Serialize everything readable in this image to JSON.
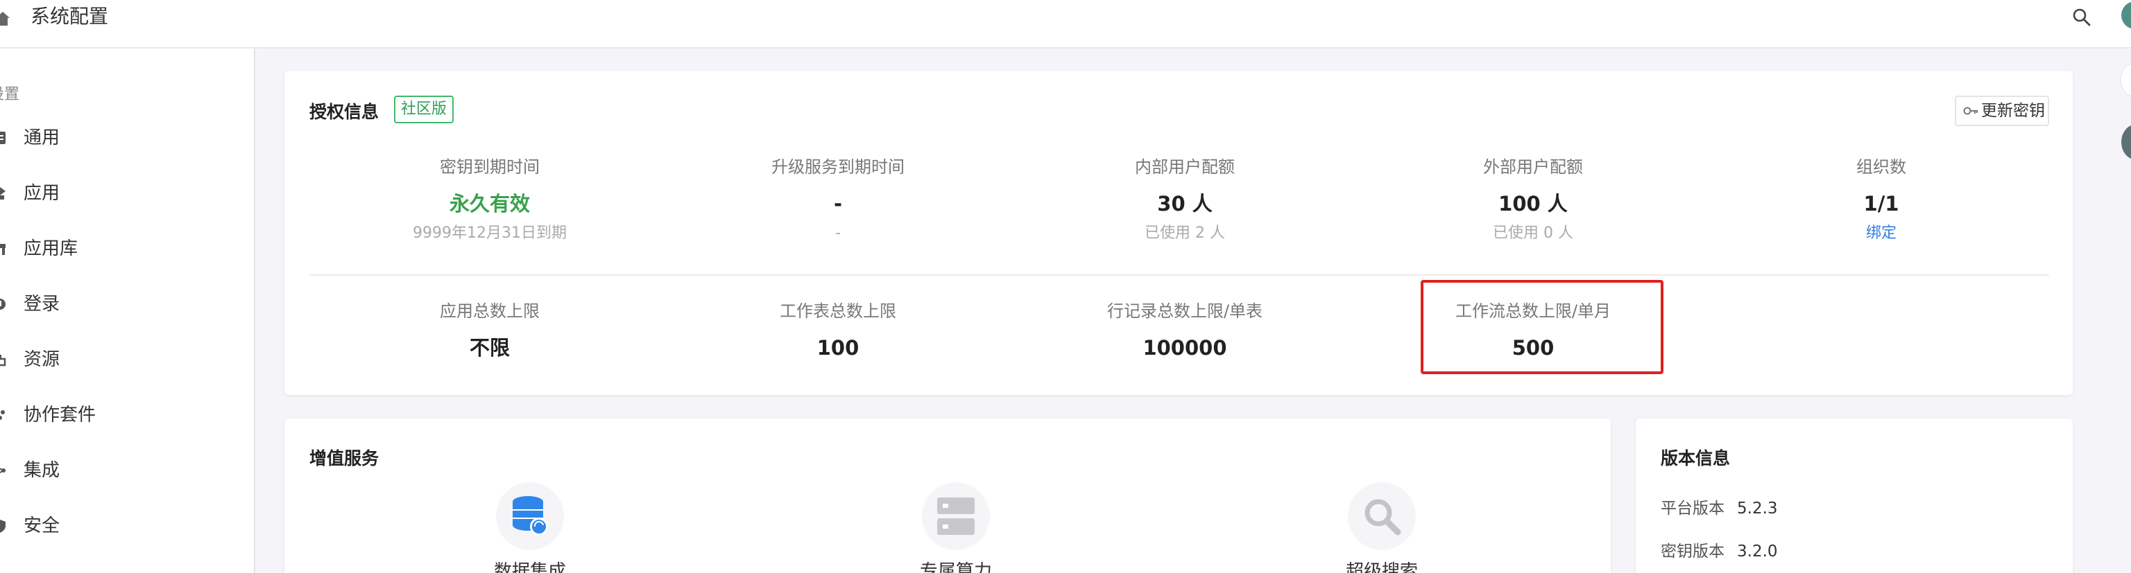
{
  "header": {
    "title": "系统配置"
  },
  "sidebar": {
    "group_label": "设置",
    "items": [
      {
        "label": "通用",
        "icon": "doc-icon"
      },
      {
        "label": "应用",
        "icon": "apps-icon"
      },
      {
        "label": "应用库",
        "icon": "store-icon"
      },
      {
        "label": "登录",
        "icon": "login-icon"
      },
      {
        "label": "资源",
        "icon": "resource-icon"
      },
      {
        "label": "协作套件",
        "icon": "suite-icon"
      },
      {
        "label": "集成",
        "icon": "integration-icon"
      },
      {
        "label": "安全",
        "icon": "shield-icon"
      }
    ]
  },
  "license": {
    "title": "授权信息",
    "edition": "社区版",
    "update_key_label": "更新密钥",
    "stats_row1": [
      {
        "label": "密钥到期时间",
        "value": "永久有效",
        "sub": "9999年12月31日到期"
      },
      {
        "label": "升级服务到期时间",
        "value": "-",
        "sub": "-"
      },
      {
        "label": "内部用户配额",
        "value": "30 人",
        "sub": "已使用 2 人"
      },
      {
        "label": "外部用户配额",
        "value": "100 人",
        "sub": "已使用 0 人"
      },
      {
        "label": "组织数",
        "value": "1/1",
        "sub": "绑定"
      }
    ],
    "stats_row2": [
      {
        "label": "应用总数上限",
        "value": "不限"
      },
      {
        "label": "工作表总数上限",
        "value": "100"
      },
      {
        "label": "行记录总数上限/单表",
        "value": "100000"
      },
      {
        "label": "工作流总数上限/单月",
        "value": "500"
      }
    ]
  },
  "value_added": {
    "title": "增值服务",
    "services": [
      {
        "label": "数据集成",
        "icon": "database-sync-icon"
      },
      {
        "label": "专属算力",
        "icon": "server-icon"
      },
      {
        "label": "超级搜索",
        "icon": "magnifier-icon"
      }
    ]
  },
  "version": {
    "title": "版本信息",
    "rows": [
      {
        "label": "平台版本",
        "value": "5.2.3"
      },
      {
        "label": "密钥版本",
        "value": "3.2.0"
      }
    ]
  },
  "colors": {
    "accent_green": "#3aa14b",
    "link_blue": "#2f7fe0",
    "highlight_red": "#e02020"
  }
}
